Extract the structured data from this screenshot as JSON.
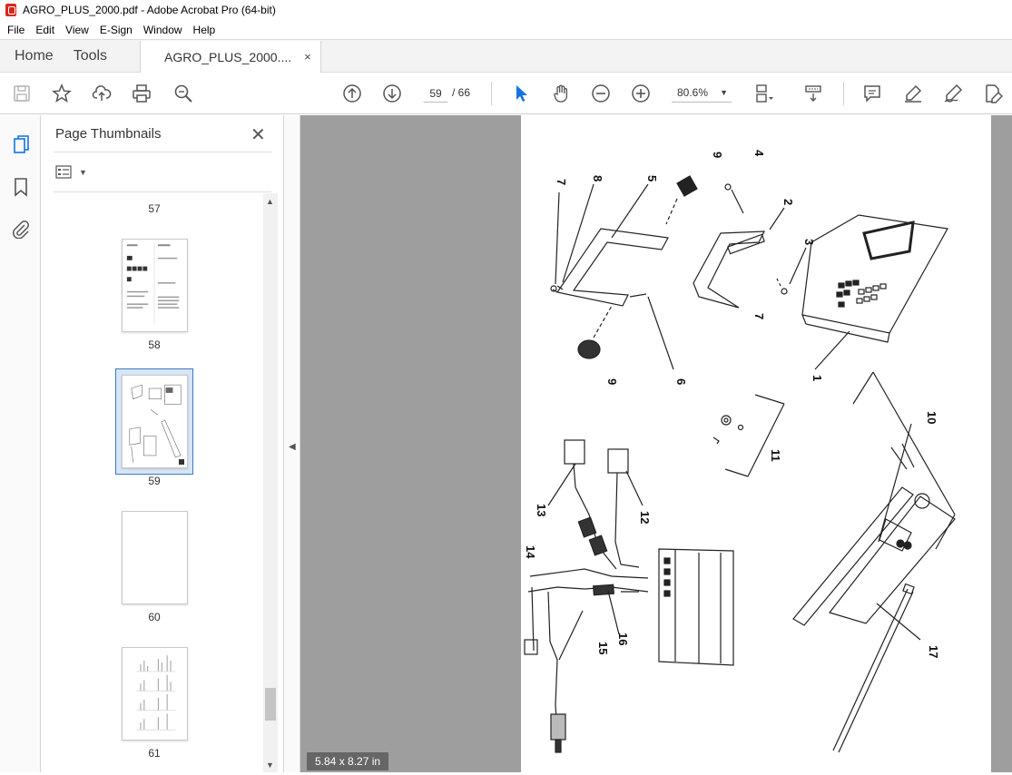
{
  "window": {
    "title": "AGRO_PLUS_2000.pdf - Adobe Acrobat Pro (64-bit)"
  },
  "menu": [
    "File",
    "Edit",
    "View",
    "E-Sign",
    "Window",
    "Help"
  ],
  "tabs": {
    "home": "Home",
    "tools": "Tools",
    "document": "AGRO_PLUS_2000....",
    "close": "×"
  },
  "toolbar": {
    "current_page": "59",
    "page_total": "/ 66",
    "zoom": "80.6%"
  },
  "thumbnails": {
    "title": "Page Thumbnails",
    "close": "✕",
    "pages": [
      {
        "label": "57"
      },
      {
        "label": "58"
      },
      {
        "label": "59",
        "selected": true
      },
      {
        "label": "60"
      },
      {
        "label": "61"
      }
    ]
  },
  "document": {
    "page_size": "5.84 x 8.27 in",
    "diagram_labels": [
      "9",
      "4",
      "7",
      "8",
      "5",
      "2",
      "3",
      "7",
      "9",
      "6",
      "1",
      "10",
      "11",
      "12",
      "13",
      "14",
      "15",
      "16",
      "17"
    ]
  },
  "colors": {
    "accent": "#1473e6",
    "select_blue": "#d7e5f6",
    "doc_bg": "#9e9e9e",
    "brand_red": "#d9261c"
  }
}
